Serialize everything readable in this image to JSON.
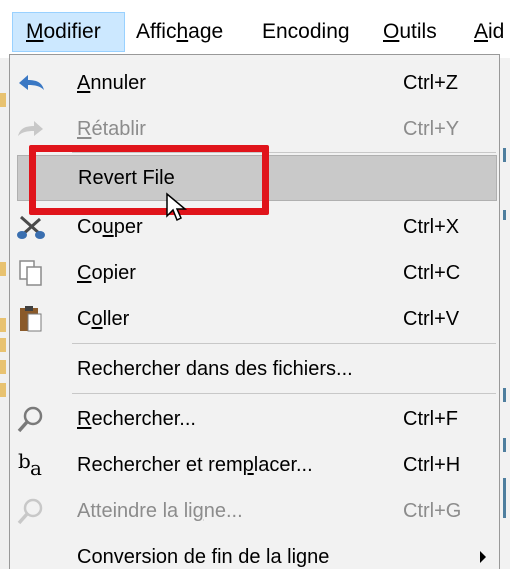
{
  "menubar": {
    "items": [
      {
        "label_pre": "",
        "label_ul": "M",
        "label_post": "odifier",
        "active": true
      },
      {
        "label_pre": "Affic",
        "label_ul": "h",
        "label_post": "age",
        "active": false
      },
      {
        "label_pre": "Encoding",
        "label_ul": "",
        "label_post": "",
        "active": false
      },
      {
        "label_pre": "",
        "label_ul": "O",
        "label_post": "utils",
        "active": false
      },
      {
        "label_pre": "",
        "label_ul": "A",
        "label_post": "id",
        "active": false
      }
    ]
  },
  "menu": {
    "undo": {
      "pre": "",
      "ul": "A",
      "post": "nnuler",
      "shortcut": "Ctrl+Z",
      "icon": "undo-icon"
    },
    "redo": {
      "pre": "",
      "ul": "R",
      "post": "établir",
      "shortcut": "Ctrl+Y",
      "icon": "redo-icon"
    },
    "revert": {
      "label": "Revert File"
    },
    "cut": {
      "pre": "Co",
      "ul": "u",
      "post": "per",
      "shortcut": "Ctrl+X",
      "icon": "scissors-icon"
    },
    "copy": {
      "pre": "",
      "ul": "C",
      "post": "opier",
      "shortcut": "Ctrl+C",
      "icon": "copy-icon"
    },
    "paste": {
      "pre": "C",
      "ul": "o",
      "post": "ller",
      "shortcut": "Ctrl+V",
      "icon": "clipboard-icon"
    },
    "find_in_files": {
      "label": "Rechercher dans des fichiers..."
    },
    "find": {
      "pre": "",
      "ul": "R",
      "post": "echercher...",
      "shortcut": "Ctrl+F",
      "icon": "magnifier-icon"
    },
    "replace": {
      "pre": "Rechercher et rem",
      "ul": "p",
      "post": "lacer...",
      "shortcut": "Ctrl+H",
      "icon": "replace-icon",
      "icon_text_b": "b",
      "icon_text_a": "a"
    },
    "goto": {
      "pre": "Atteindre la li",
      "ul": "g",
      "post": "ne...",
      "shortcut": "Ctrl+G",
      "icon": "magnifier-icon"
    },
    "eol": {
      "label": "Conversion de fin de la ligne"
    }
  },
  "colors": {
    "highlight": "#e0141b",
    "hover": "#c9c9c9",
    "disabled": "#8c8c8c",
    "menu_bg": "#f2f2f2"
  }
}
